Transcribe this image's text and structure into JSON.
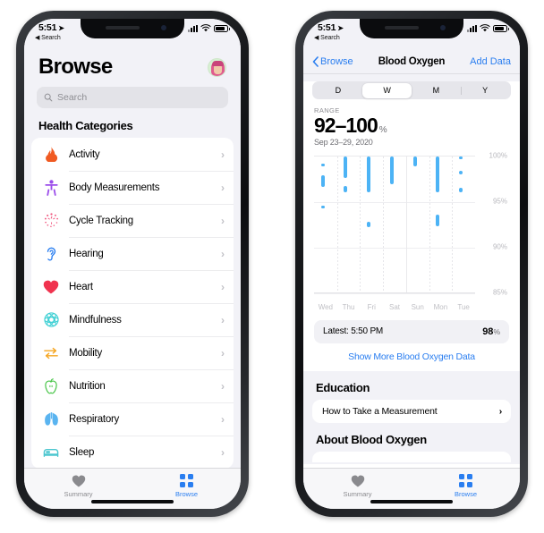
{
  "statusbar": {
    "time": "5:51",
    "back_label": "Search",
    "location_icon": "location-arrow-icon",
    "wifi_icon": "wifi-icon",
    "battery_icon": "battery-icon",
    "signal_icon": "cellular-bars-icon"
  },
  "left_phone": {
    "title": "Browse",
    "avatar_name": "profile-avatar",
    "search": {
      "placeholder": "Search",
      "icon": "search-icon"
    },
    "section_title": "Health Categories",
    "categories": [
      {
        "label": "Activity",
        "icon": "flame-icon",
        "color": "#f05a22"
      },
      {
        "label": "Body Measurements",
        "icon": "body-icon",
        "color": "#9b4dea"
      },
      {
        "label": "Cycle Tracking",
        "icon": "cycle-icon",
        "color": "#f0577f"
      },
      {
        "label": "Hearing",
        "icon": "ear-icon",
        "color": "#2a7ef0"
      },
      {
        "label": "Heart",
        "icon": "heart-icon",
        "color": "#f0334f"
      },
      {
        "label": "Mindfulness",
        "icon": "mindfulness-icon",
        "color": "#3fd0d4"
      },
      {
        "label": "Mobility",
        "icon": "mobility-icon",
        "color": "#f5a623"
      },
      {
        "label": "Nutrition",
        "icon": "apple-icon",
        "color": "#4cc64c"
      },
      {
        "label": "Respiratory",
        "icon": "lungs-icon",
        "color": "#5ab4f0"
      },
      {
        "label": "Sleep",
        "icon": "bed-icon",
        "color": "#4cc6cf"
      }
    ]
  },
  "right_phone": {
    "nav": {
      "back": "Browse",
      "title": "Blood Oxygen",
      "action": "Add Data"
    },
    "segments": [
      {
        "label": "D",
        "selected": false
      },
      {
        "label": "W",
        "selected": true
      },
      {
        "label": "M",
        "selected": false
      },
      {
        "label": "Y",
        "selected": false
      }
    ],
    "range_label": "RANGE",
    "range_value": "92–100",
    "range_unit": "%",
    "range_date": "Sep 23–29, 2020",
    "latest": {
      "label": "Latest: 5:50 PM",
      "value": "98",
      "unit": "%"
    },
    "show_more": "Show More Blood Oxygen Data",
    "education_title": "Education",
    "education_item": "How to Take a Measurement",
    "about_title": "About Blood Oxygen"
  },
  "tabbar": {
    "tabs": [
      {
        "label": "Summary",
        "icon": "heart-icon",
        "active": false
      },
      {
        "label": "Browse",
        "icon": "grid-icon",
        "active": true
      }
    ],
    "active_color": "#2a7ef0",
    "inactive_color": "#8a8a8e"
  },
  "chart_data": {
    "type": "bar",
    "title": "Blood Oxygen",
    "subtitle": "Sep 23–29, 2020",
    "xlabel": "",
    "ylabel": "%",
    "ylim": [
      85,
      100
    ],
    "yticks": [
      85,
      90,
      95,
      100
    ],
    "ytick_labels": [
      "85%",
      "90%",
      "95%",
      "100%"
    ],
    "grid": true,
    "legend": false,
    "bar_color": "#4cb3f5",
    "categories": [
      "Wed",
      "Thu",
      "Fri",
      "Sat",
      "Sun",
      "Mon",
      "Tue"
    ],
    "series": [
      {
        "name": "Blood Oxygen range per reading",
        "ranges": [
          {
            "day": "Wed",
            "low": 98.9,
            "high": 99.2
          },
          {
            "day": "Wed",
            "low": 96.6,
            "high": 97.9
          },
          {
            "day": "Wed",
            "low": 94.3,
            "high": 94.6
          },
          {
            "day": "Thu",
            "low": 97.6,
            "high": 100.0
          },
          {
            "day": "Thu",
            "low": 96.1,
            "high": 96.7
          },
          {
            "day": "Fri",
            "low": 96.1,
            "high": 100.0
          },
          {
            "day": "Fri",
            "low": 92.2,
            "high": 92.8
          },
          {
            "day": "Sat",
            "low": 96.9,
            "high": 100.0
          },
          {
            "day": "Sun",
            "low": 98.9,
            "high": 100.0
          },
          {
            "day": "Mon",
            "low": 96.1,
            "high": 100.0
          },
          {
            "day": "Mon",
            "low": 92.3,
            "high": 93.6
          },
          {
            "day": "Tue",
            "low": 99.8,
            "high": 100.0
          },
          {
            "day": "Tue",
            "low": 98.0,
            "high": 98.4
          },
          {
            "day": "Tue",
            "low": 96.1,
            "high": 96.6
          }
        ]
      }
    ]
  }
}
